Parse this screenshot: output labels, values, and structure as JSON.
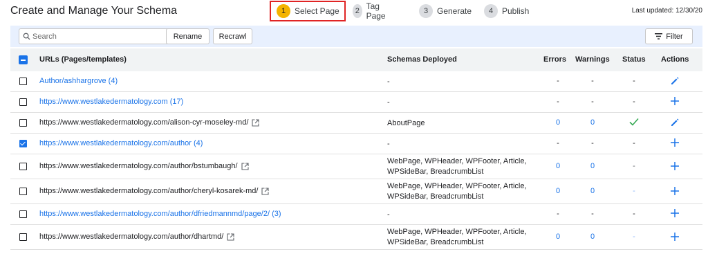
{
  "header": {
    "title": "Create and Manage Your Schema",
    "last_updated": "Last updated: 12/30/20",
    "steps": [
      {
        "num": "1",
        "label": "Select Page"
      },
      {
        "num": "2",
        "label": "Tag Page"
      },
      {
        "num": "3",
        "label": "Generate"
      },
      {
        "num": "4",
        "label": "Publish"
      }
    ]
  },
  "toolbar": {
    "search_placeholder": "Search",
    "rename_label": "Rename",
    "recrawl_label": "Recrawl",
    "filter_label": "Filter"
  },
  "table": {
    "columns": {
      "url": "URLs (Pages/templates)",
      "schemas": "Schemas Deployed",
      "errors": "Errors",
      "warnings": "Warnings",
      "status": "Status",
      "actions": "Actions"
    },
    "rows": [
      {
        "url": "Author/ashhargrove (4)",
        "schemas_line1": "-",
        "schemas_line2": "",
        "errors": "-",
        "warnings": "-",
        "status": "-",
        "action": "edit"
      },
      {
        "url": "https://www.westlakedermatology.com (17)",
        "schemas_line1": "-",
        "schemas_line2": "",
        "errors": "-",
        "warnings": "-",
        "status": "-",
        "action": "add"
      },
      {
        "url": "https://www.westlakedermatology.com/alison-cyr-moseley-md/",
        "schemas_line1": "AboutPage",
        "schemas_line2": "",
        "errors": "0",
        "warnings": "0",
        "status": "check",
        "action": "edit"
      },
      {
        "url": "https://www.westlakedermatology.com/author (4)",
        "schemas_line1": "-",
        "schemas_line2": "",
        "errors": "-",
        "warnings": "-",
        "status": "-",
        "action": "add"
      },
      {
        "url": "https://www.westlakedermatology.com/author/bstumbaugh/",
        "schemas_line1": "WebPage, WPHeader, WPFooter, Article,",
        "schemas_line2": "WPSideBar, BreadcrumbList",
        "errors": "0",
        "warnings": "0",
        "status": "-",
        "action": "add"
      },
      {
        "url": "https://www.westlakedermatology.com/author/cheryl-kosarek-md/",
        "schemas_line1": "WebPage, WPHeader, WPFooter, Article,",
        "schemas_line2": "WPSideBar, BreadcrumbList",
        "errors": "0",
        "warnings": "0",
        "status": "-",
        "action": "add"
      },
      {
        "url": "https://www.westlakedermatology.com/author/dfriedmannmd/page/2/ (3)",
        "schemas_line1": "-",
        "schemas_line2": "",
        "errors": "-",
        "warnings": "-",
        "status": "-",
        "action": "add"
      },
      {
        "url": "https://www.westlakedermatology.com/author/dhartmd/",
        "schemas_line1": "WebPage, WPHeader, WPFooter, Article,",
        "schemas_line2": "WPSideBar, BreadcrumbList",
        "errors": "0",
        "warnings": "0",
        "status": "-",
        "action": "add"
      }
    ]
  },
  "colors": {
    "accent": "#1a73e8",
    "active_step": "#f4b400",
    "highlight_border": "#e02424",
    "success": "#34a853"
  }
}
